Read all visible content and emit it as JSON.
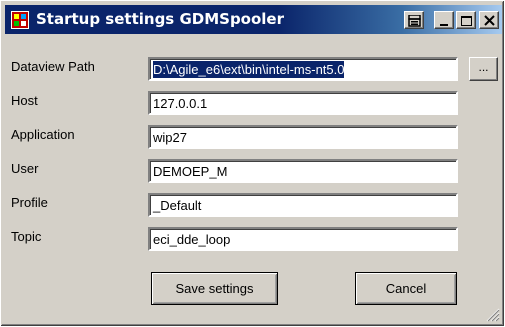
{
  "window": {
    "title": "Startup settings GDMSpooler",
    "controls": [
      "restore-dock-icon",
      "minimize-icon",
      "maximize-icon",
      "close-icon"
    ]
  },
  "form": {
    "fields": [
      {
        "label": "Dataview Path",
        "value": "D:\\Agile_e6\\ext\\bin\\intel-ms-nt5.0",
        "selected": true
      },
      {
        "label": "Host",
        "value": "127.0.0.1"
      },
      {
        "label": "Application",
        "value": "wip27"
      },
      {
        "label": "User",
        "value": "DEMOEP_M"
      },
      {
        "label": "Profile",
        "value": "_Default"
      },
      {
        "label": "Topic",
        "value": "eci_dde_loop"
      }
    ],
    "browse_label": "...",
    "save_label": "Save settings",
    "cancel_label": "Cancel"
  },
  "colors": {
    "title_active": "#0a246a",
    "dialog_face": "#d4d0c8",
    "selection": "#0a246a"
  }
}
